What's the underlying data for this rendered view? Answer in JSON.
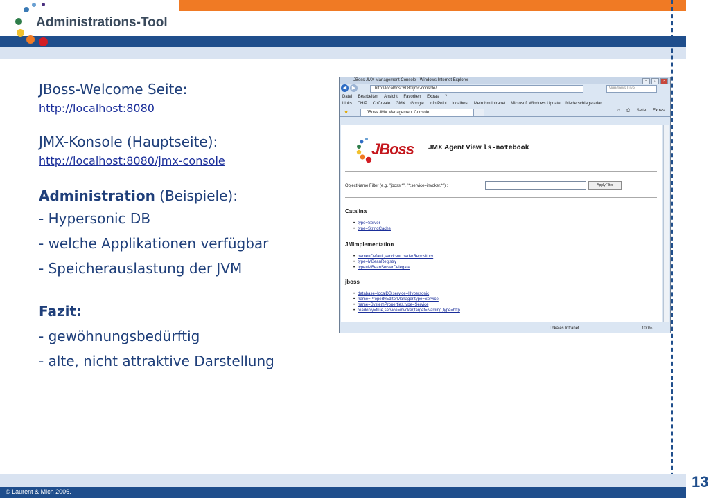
{
  "slide": {
    "title": "Administrations-Tool",
    "page_number": "13",
    "copyright": "© Laurent & Mich 2006.",
    "colors": {
      "orange": "#f07a24",
      "navy": "#1f4e8c",
      "text": "#1f3f7a",
      "link": "#1a2e9a"
    }
  },
  "content": {
    "welcome_label": "JBoss-Welcome Seite:",
    "welcome_link": "http://localhost:8080",
    "jmx_label": "JMX-Konsole (Hauptseite):",
    "jmx_link": "http://localhost:8080/jmx-console",
    "admin_bold": "Administration",
    "admin_rest": " (Beispiele):",
    "admin_items": [
      "- Hypersonic DB",
      "- welche Applikationen verfügbar",
      "- Speicherauslastung der JVM"
    ],
    "fazit_label": "Fazit:",
    "fazit_items": [
      "- gewöhnungsbedürftig",
      "- alte, nicht attraktive Darstellung"
    ]
  },
  "browser": {
    "window_title": "JBoss JMX Management Console - Windows Internet Explorer",
    "address": "http://localhost:8080/jmx-console/",
    "search_placeholder": "Windows Live",
    "menu": [
      "Datei",
      "Bearbeiten",
      "Ansicht",
      "Favoriten",
      "Extras",
      "?"
    ],
    "links_bar": [
      "Links",
      "CHIP",
      "CoCreate",
      "GMX",
      "Google",
      "Info Point",
      "localhost",
      "Metrohm Intranet",
      "Microsoft Windows Update",
      "Niederschlagsradar"
    ],
    "tab_title": "JBoss JMX Management Console",
    "tools": [
      "Seite",
      "Extras"
    ],
    "status_zone": "Lokales Intranet",
    "status_zoom": "100%",
    "page": {
      "logo_text": "JBoss",
      "agent_view_label": "JMX Agent View",
      "host": "ls-notebook",
      "filter_label": "ObjectName Filter (e.g. \"jboss:*\", \"*:service=invoker,*\") :",
      "apply_label": "ApplyFilter",
      "domains": [
        {
          "name": "Catalina",
          "items": [
            "type=Server",
            "type=StringCache"
          ]
        },
        {
          "name": "JMImplementation",
          "items": [
            "name=Default,service=LoaderRepository",
            "type=MBeanRegistry",
            "type=MBeanServerDelegate"
          ]
        },
        {
          "name": "jboss",
          "items": [
            "database=localDB,service=Hypersonic",
            "name=PropertyEditorManager,type=Service",
            "name=SystemProperties,type=Service",
            "readonly=true,service=invoker,target=Naming,type=http"
          ]
        }
      ]
    }
  }
}
